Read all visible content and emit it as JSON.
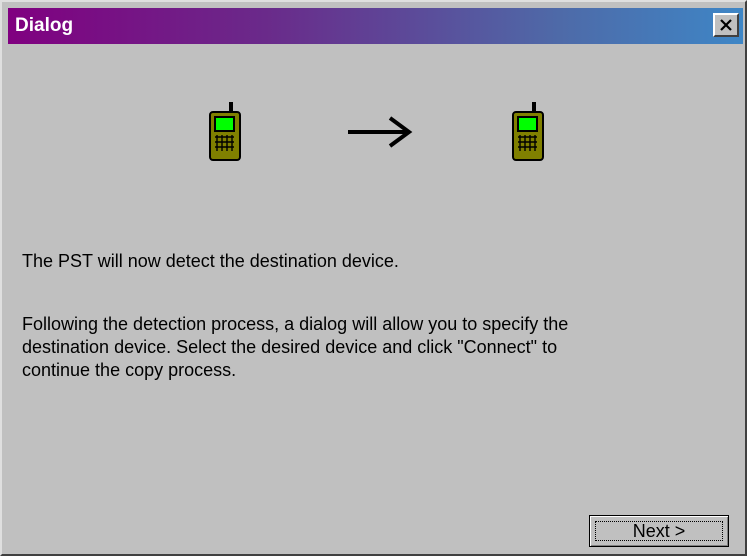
{
  "window": {
    "title": "Dialog"
  },
  "titlebar_buttons": {
    "close_icon": "close-x-icon"
  },
  "illustration": {
    "source_icon": "mobile-phone-icon",
    "arrow_icon": "right-arrow-icon",
    "destination_icon": "mobile-phone-icon",
    "phone_body_color": "#808000",
    "phone_screen_color": "#00ff00"
  },
  "message": {
    "line1": "The PST will now detect the destination device.",
    "para2_lines": [
      "Following the detection process, a dialog will allow you to specify the",
      "destination device.  Select the desired device and click \"Connect\" to",
      "continue the copy process."
    ]
  },
  "buttons": {
    "next_label": "Next >"
  }
}
